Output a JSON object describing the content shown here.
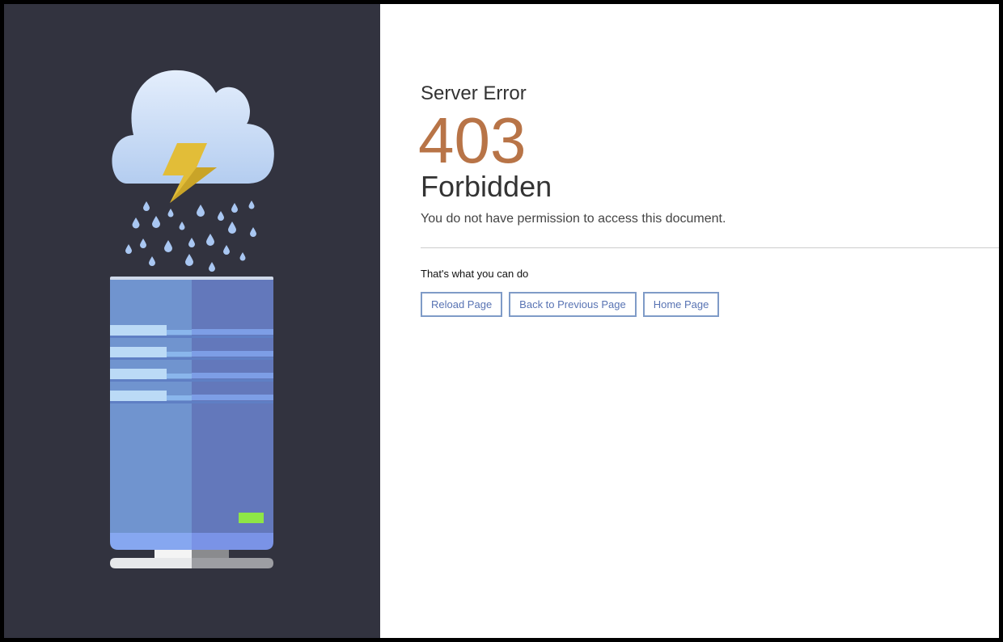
{
  "error": {
    "label": "Server Error",
    "code": "403",
    "title": "Forbidden",
    "message": "You do not have permission to access this document."
  },
  "options": {
    "heading": "That's what you can do",
    "buttons": [
      {
        "label": "Reload Page"
      },
      {
        "label": "Back to Previous Page"
      },
      {
        "label": "Home Page"
      }
    ]
  },
  "colors": {
    "panel_background": "#32333f",
    "code": "#b87447",
    "button_border": "#7f9bc7",
    "button_text": "#5873b3",
    "server_body": "#7094cf",
    "server_led": "#8ee646",
    "lightning": "#e2bd38"
  },
  "illustration": {
    "icons": [
      "storm-cloud-icon",
      "lightning-bolt-icon",
      "raindrop-icon",
      "server-tower-icon"
    ]
  }
}
